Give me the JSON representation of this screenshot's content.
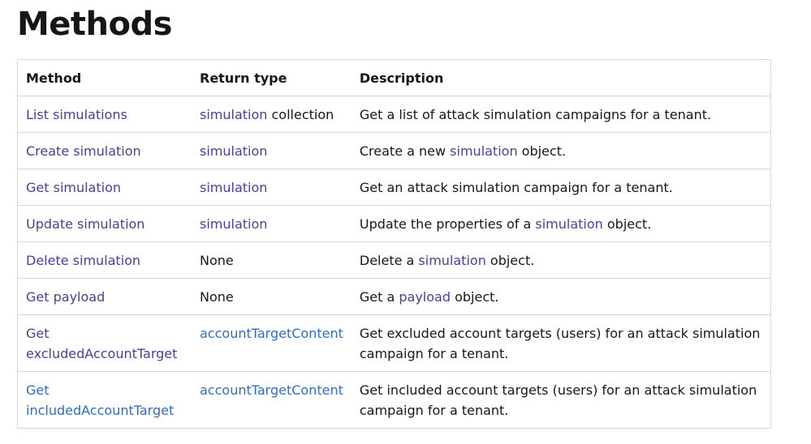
{
  "page": {
    "title": "Methods"
  },
  "table": {
    "headers": [
      "Method",
      "Return type",
      "Description"
    ],
    "rows": [
      {
        "method": "List simulations",
        "return_link": "simulation",
        "return_text": " collection",
        "desc_pre": "Get a list of attack simulation campaigns for a tenant.",
        "desc_link": "",
        "desc_post": ""
      },
      {
        "method": "Create simulation",
        "return_link": "simulation",
        "return_text": "",
        "desc_pre": "Create a new ",
        "desc_link": "simulation",
        "desc_post": " object."
      },
      {
        "method": "Get simulation",
        "return_link": "simulation",
        "return_text": "",
        "desc_pre": "Get an attack simulation campaign for a tenant.",
        "desc_link": "",
        "desc_post": ""
      },
      {
        "method": "Update simulation",
        "return_link": "simulation",
        "return_text": "",
        "desc_pre": "Update the properties of a ",
        "desc_link": "simulation",
        "desc_post": " object."
      },
      {
        "method": "Delete simulation",
        "return_link": "",
        "return_text": "None",
        "desc_pre": "Delete a ",
        "desc_link": "simulation",
        "desc_post": " object."
      },
      {
        "method": "Get payload",
        "return_link": "",
        "return_text": "None",
        "desc_pre": "Get a ",
        "desc_link": "payload",
        "desc_post": " object."
      },
      {
        "method_line1": "Get",
        "method_line2": "excludedAccountTarget",
        "return_link": "accountTargetContent",
        "return_text": "",
        "desc_pre": "Get excluded account targets (users) for an attack simulation campaign for a tenant.",
        "desc_link": "",
        "desc_post": ""
      },
      {
        "method_line1": "Get",
        "method_line2": "includedAccountTarget",
        "return_link": "accountTargetContent",
        "return_text": "",
        "desc_pre": "Get included account targets (users) for an attack simulation campaign for a tenant.",
        "desc_link": "",
        "desc_post": ""
      }
    ]
  },
  "colors": {
    "link_purple": "#4c3e96",
    "link_blue": "#2f6dc4",
    "border": "#d6d6d6",
    "text": "#171717"
  }
}
